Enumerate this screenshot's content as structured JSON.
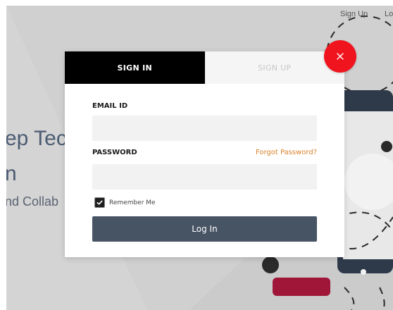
{
  "background": {
    "nav": {
      "signup": "Sign Up",
      "login": "Lo"
    },
    "hero_line1": "ep Tec",
    "hero_line2": "n",
    "hero_line3": "nd Collab"
  },
  "modal": {
    "tabs": [
      {
        "label": "SIGN IN",
        "active": true
      },
      {
        "label": "SIGN UP",
        "active": false
      }
    ],
    "email": {
      "label": "EMAIL ID",
      "value": "",
      "placeholder": ""
    },
    "password": {
      "label": "PASSWORD",
      "value": "",
      "placeholder": ""
    },
    "forgot_label": "Forgot Password?",
    "remember": {
      "label": "Remember Me",
      "checked": true
    },
    "login_label": "Log In",
    "close_icon": "close-icon"
  },
  "colors": {
    "active_tab": "#000000",
    "close_button": "#f0141e",
    "login_button": "#475464",
    "forgot_link": "#d9822b"
  }
}
